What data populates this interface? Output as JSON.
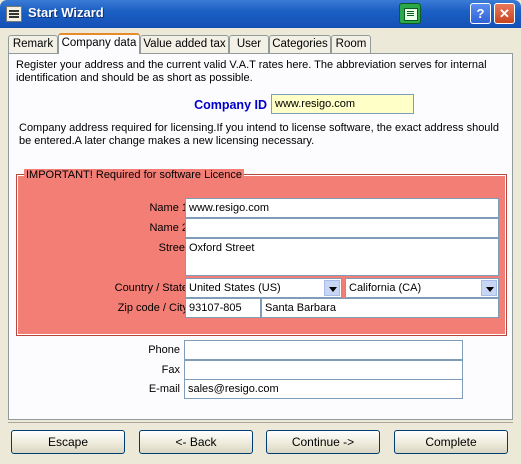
{
  "window": {
    "title": "Start Wizard"
  },
  "tabs": [
    "Remark",
    "Company data",
    "Value added tax",
    "User",
    "Categories",
    "Room"
  ],
  "intro_text": "Register your address and the current valid V.A.T rates here. The abbreviation serves for internal identification and should be as short as possible.",
  "company_id": {
    "label": "Company ID",
    "value": "www.resigo.com"
  },
  "address_note": "Company address required for licensing.If you intend to license software, the exact address should be entered.A later change makes a new licensing necessary.",
  "licence_group": {
    "legend": "IMPORTANT! Required for software Licence",
    "name1_label": "Name 1",
    "name1_value": "www.resigo.com",
    "name2_label": "Name 2",
    "name2_value": "",
    "street_label": "Street",
    "street_value": "Oxford Street",
    "country_state_label": "Country / State",
    "country_value": "United States (US)",
    "state_value": "California (CA)",
    "zip_city_label": "Zip code / City",
    "zip_value": "93107-805",
    "city_value": "Santa Barbara"
  },
  "contact": {
    "phone_label": "Phone",
    "phone_value": "",
    "fax_label": "Fax",
    "fax_value": "",
    "email_label": "E-mail",
    "email_value": "sales@resigo.com"
  },
  "buttons": {
    "escape": "Escape",
    "back": "<- Back",
    "continue": "Continue ->",
    "complete": "Complete"
  },
  "colors": {
    "licence_bg": "#f37e76",
    "company_id_label": "#0000cc",
    "company_id_field": "#ffffc8"
  }
}
